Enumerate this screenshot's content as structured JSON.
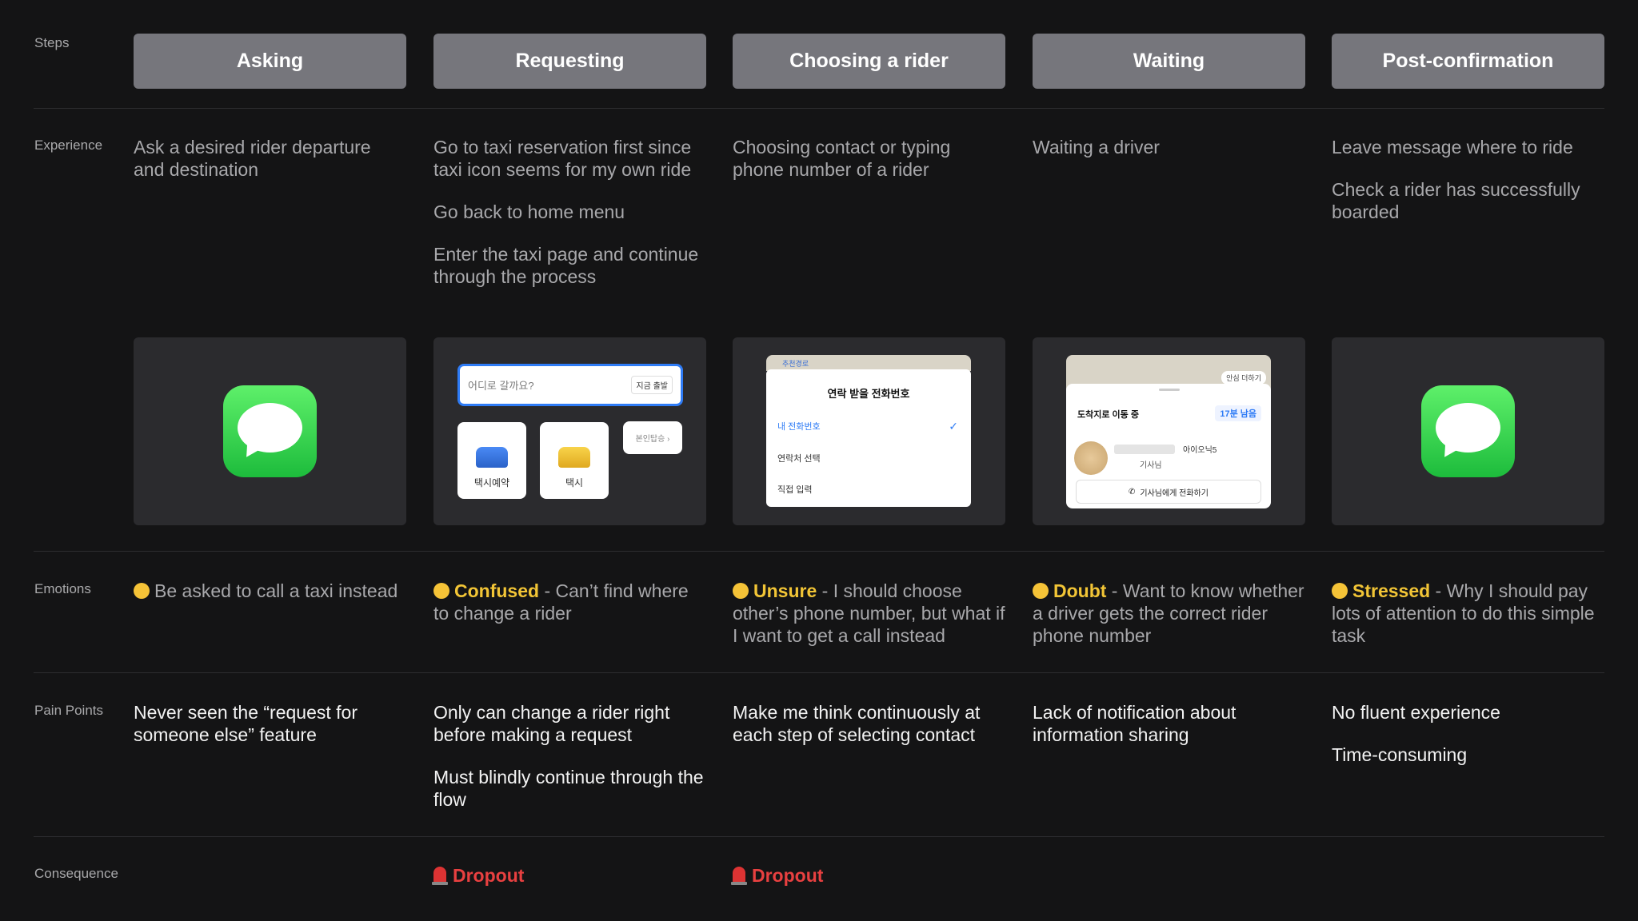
{
  "row_labels": {
    "steps": "Steps",
    "experience": "Experience",
    "emotions": "Emotions",
    "pain_points": "Pain Points",
    "consequence": "Consequence"
  },
  "steps": [
    "Asking",
    "Requesting",
    "Choosing a rider",
    "Waiting",
    "Post-confirmation"
  ],
  "experience": [
    [
      "Ask a desired rider departure and destination"
    ],
    [
      "Go to taxi reservation first since taxi icon seems for my own ride",
      "Go back to home menu",
      "Enter the taxi page and continue through the process"
    ],
    [
      "Choosing contact or typing phone number of a rider"
    ],
    [
      "Waiting a driver"
    ],
    [
      "Leave message where to ride",
      "Check a rider has successfully boarded"
    ]
  ],
  "emotions": [
    {
      "word": "",
      "text": "Be asked to call a taxi instead"
    },
    {
      "word": "Confused",
      "text": " - Can’t find where to change a rider"
    },
    {
      "word": "Unsure",
      "text": " - I should choose other’s phone number, but what if I want to get a call instead"
    },
    {
      "word": "Doubt",
      "text": " - Want to know whether a driver gets the correct rider phone number"
    },
    {
      "word": "Stressed",
      "text": " - Why I should pay lots of attention to do this simple task"
    }
  ],
  "pain_points": [
    [
      "Never seen the “request for someone else” feature"
    ],
    [
      "Only can change a rider right before making a request",
      "Must blindly continue through the flow"
    ],
    [
      "Make me think continuously at each step of selecting contact"
    ],
    [
      "Lack of notification about information sharing"
    ],
    [
      "No fluent experience",
      "Time-consuming"
    ]
  ],
  "consequence": [
    "",
    "Dropout",
    "Dropout",
    "",
    ""
  ],
  "screens": {
    "requesting": {
      "search_placeholder": "어디로 갈까요?",
      "now_button": "지금 출발",
      "tile_reserve": "택시예약",
      "tile_taxi": "택시",
      "self_ride": "본인탑승 ›"
    },
    "choosing": {
      "map_label": "추천경로",
      "title": "연락 받을 전화번호",
      "options": [
        "내 전화번호",
        "연락처 선택",
        "직접 입력"
      ]
    },
    "waiting": {
      "safe_label": "안심 더하기",
      "status": "도착지로 이동 중",
      "time_left": "17분 남음",
      "car": "아이오닉5",
      "driver": "기사님",
      "call_button": "기사님에게 전화하기"
    }
  },
  "colors": {
    "background": "#141415",
    "header": "#76767c",
    "emotion_accent": "#f2c536",
    "dropout": "#e84040",
    "messages_green": "#28c840"
  }
}
